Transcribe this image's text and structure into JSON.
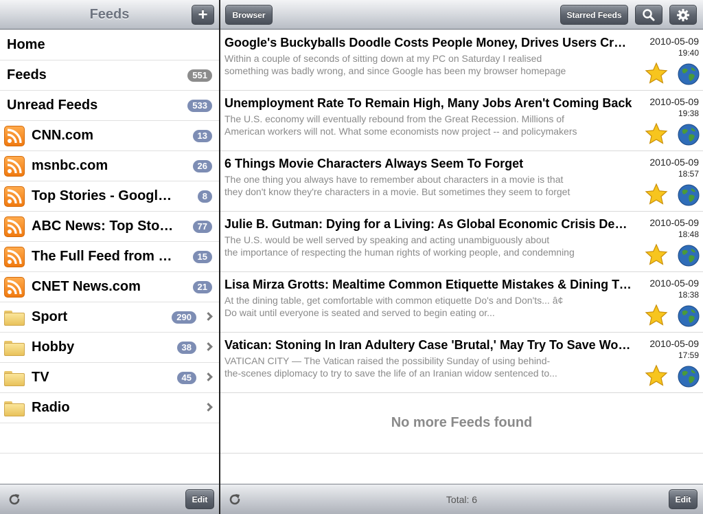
{
  "sidebar": {
    "title": "Feeds",
    "add_label": "+",
    "items": [
      {
        "label": "Home",
        "count": "",
        "icon": "none"
      },
      {
        "label": "Feeds",
        "count": "551",
        "icon": "none"
      },
      {
        "label": "Unread Feeds",
        "count": "533",
        "icon": "none"
      },
      {
        "label": "CNN.com",
        "count": "13",
        "icon": "rss-icon"
      },
      {
        "label": "msnbc.com",
        "count": "26",
        "icon": "rss-icon"
      },
      {
        "label": "Top Stories - Google News",
        "count": "8",
        "icon": "rss-icon"
      },
      {
        "label": "ABC News: Top Stories",
        "count": "77",
        "icon": "rss-icon"
      },
      {
        "label": "The Full Feed from HuffingtonPost.com",
        "count": "15",
        "icon": "rss-icon"
      },
      {
        "label": "CNET News.com",
        "count": "21",
        "icon": "rss-icon"
      },
      {
        "label": "Sport",
        "count": "290",
        "icon": "folder-icon"
      },
      {
        "label": "Hobby",
        "count": "38",
        "icon": "folder-icon"
      },
      {
        "label": "TV",
        "count": "45",
        "icon": "folder-icon"
      },
      {
        "label": "Radio",
        "count": "",
        "icon": "folder-icon"
      }
    ],
    "edit_label": "Edit"
  },
  "toolbar": {
    "browser_label": "Browser",
    "starred_label": "Starred Feeds"
  },
  "feeds": [
    {
      "title": "Google's Buckyballs Doodle Costs People Money, Drives Users Crazy",
      "summary_line1": "Within a couple of seconds of sitting down at my PC on Saturday I realised",
      "summary_line2": "something was badly wrong, and since Google has been my browser homepage",
      "date": "2010-05-09",
      "time": "19:40"
    },
    {
      "title": "Unemployment Rate To Remain High, Many Jobs Aren't Coming Back",
      "summary_line1": "The U.S. economy will eventually rebound from the Great Recession. Millions of",
      "summary_line2": "American workers will not. What some economists now project -- and policymakers",
      "date": "2010-05-09",
      "time": "19:38"
    },
    {
      "title": "6 Things Movie Characters Always Seem To Forget",
      "summary_line1": "The one thing you always have to remember about characters in a movie is that",
      "summary_line2": "they don't know they're characters in a movie. But sometimes they seem to forget",
      "date": "2010-05-09",
      "time": "18:57"
    },
    {
      "title": "Julie B. Gutman: Dying for a Living: As Global Economic Crisis Deepens",
      "summary_line1": "The U.S. would be well served by speaking and acting unambiguously about",
      "summary_line2": "the importance of respecting the human rights of working people, and condemning",
      "date": "2010-05-09",
      "time": "18:48"
    },
    {
      "title": "Lisa Mirza Grotts: Mealtime Common Etiquette Mistakes & Dining Tips",
      "summary_line1": "At the dining table, get comfortable with common etiquette Do's and Don'ts... â¢",
      "summary_line2": "Do wait until everyone is seated and served to begin eating or...",
      "date": "2010-05-09",
      "time": "18:38"
    },
    {
      "title": "Vatican: Stoning In Iran Adultery Case 'Brutal,' May Try To Save Woman",
      "summary_line1": "VATICAN CITY — The Vatican raised the possibility Sunday of using behind-",
      "summary_line2": "the-scenes diplomacy to try to save the life of an Iranian widow sentenced to...",
      "date": "2010-05-09",
      "time": "17:59"
    }
  ],
  "no_more_text": "No more Feeds found",
  "footer": {
    "total_text": "Total: 6",
    "edit_label": "Edit"
  },
  "colors": {
    "badge_grey": "#8c8c8c",
    "badge_blue": "#7d8db4",
    "rss_orange": "#f07a10"
  }
}
